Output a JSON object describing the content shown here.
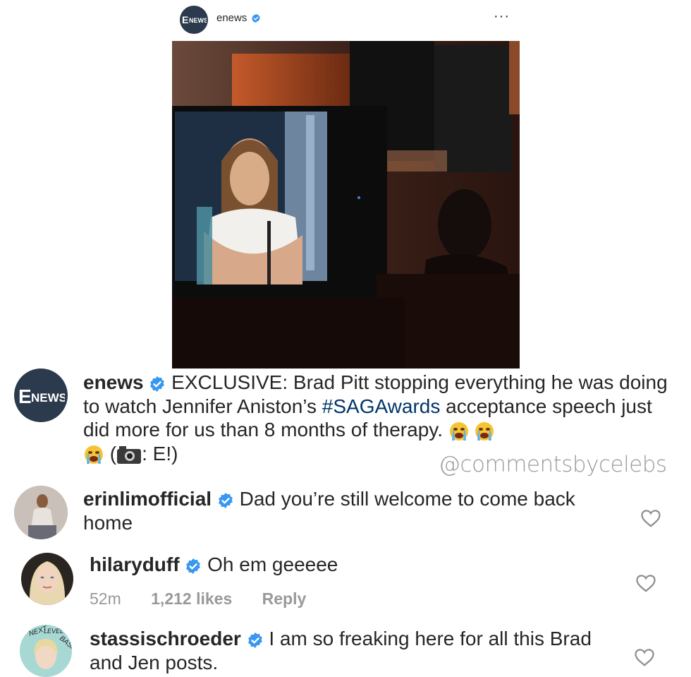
{
  "post": {
    "username": "enews",
    "more_label": "···",
    "avatar_text": "E!NEWS"
  },
  "caption": {
    "username": "enews",
    "text_before_hashtag": " EXCLUSIVE: Brad Pitt stopping everything he was doing to watch Jennifer Aniston’s ",
    "hashtag": "#SAGAwards",
    "text_after_hashtag": " acceptance speech just did more for us than 8 months of therapy. ",
    "credit_open": " (",
    "credit_close": ": E!)",
    "emoji_icons": [
      "crying-face-icon",
      "crying-face-icon",
      "crying-face-icon",
      "camera-icon"
    ]
  },
  "watermark": "@commentsbycelebs",
  "comments": [
    {
      "username": "erinlimofficial",
      "text": " Dad you’re still welcome to come back home"
    },
    {
      "username": "hilaryduff",
      "text": " Oh em geeeee",
      "time": "52m",
      "likes": "1,212 likes",
      "reply": "Reply"
    },
    {
      "username": "stassischroeder",
      "text": " I am so freaking here for all this Brad and Jen posts.",
      "avatar_text": "NEXT LEVEL BASIC"
    }
  ],
  "colors": {
    "verified": "#3897f0",
    "hashtag": "#003569",
    "meta": "#999999",
    "watermark": "#9a9a9a"
  }
}
